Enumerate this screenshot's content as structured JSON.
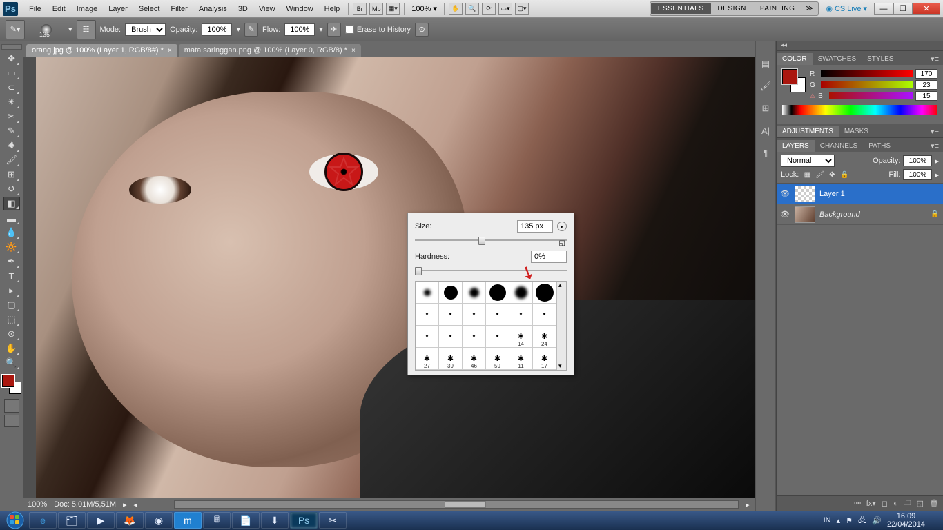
{
  "menubar": {
    "items": [
      "File",
      "Edit",
      "Image",
      "Layer",
      "Select",
      "Filter",
      "Analysis",
      "3D",
      "View",
      "Window",
      "Help"
    ],
    "zoom": "100%",
    "workspaces": [
      "ESSENTIALS",
      "DESIGN",
      "PAINTING"
    ],
    "cslive": "CS Live"
  },
  "optbar": {
    "brush_size": "135",
    "mode_label": "Mode:",
    "mode_value": "Brush",
    "opacity_label": "Opacity:",
    "opacity_value": "100%",
    "flow_label": "Flow:",
    "flow_value": "100%",
    "erase_label": "Erase to History"
  },
  "tabs": [
    {
      "label": "orang.jpg @ 100% (Layer 1, RGB/8#) *"
    },
    {
      "label": "mata saringgan.png @ 100% (Layer 0, RGB/8) *"
    }
  ],
  "status": {
    "zoom": "100%",
    "doc": "Doc: 5,01M/5,51M"
  },
  "brush_popup": {
    "size_label": "Size:",
    "size_value": "135 px",
    "hardness_label": "Hardness:",
    "hardness_value": "0%",
    "preset_labels": [
      "",
      "",
      "",
      "",
      "",
      "",
      "",
      "",
      "",
      "",
      "",
      "",
      "",
      "",
      "",
      "",
      "14",
      "24",
      "27",
      "39",
      "46",
      "59",
      "11",
      "17"
    ]
  },
  "color_panel": {
    "tabs": [
      "COLOR",
      "SWATCHES",
      "STYLES"
    ],
    "r": "170",
    "g": "23",
    "b": "15",
    "fg": "#aa170f"
  },
  "adjustments": {
    "tabs": [
      "ADJUSTMENTS",
      "MASKS"
    ]
  },
  "layers_panel": {
    "tabs": [
      "LAYERS",
      "CHANNELS",
      "PATHS"
    ],
    "blend": "Normal",
    "opacity_label": "Opacity:",
    "opacity": "100%",
    "lock_label": "Lock:",
    "fill_label": "Fill:",
    "fill": "100%",
    "layers": [
      {
        "name": "Layer 1",
        "selected": true,
        "trans": true
      },
      {
        "name": "Background",
        "locked": true
      }
    ]
  },
  "taskbar": {
    "lang": "IN",
    "time": "16:09",
    "date": "22/04/2014"
  }
}
